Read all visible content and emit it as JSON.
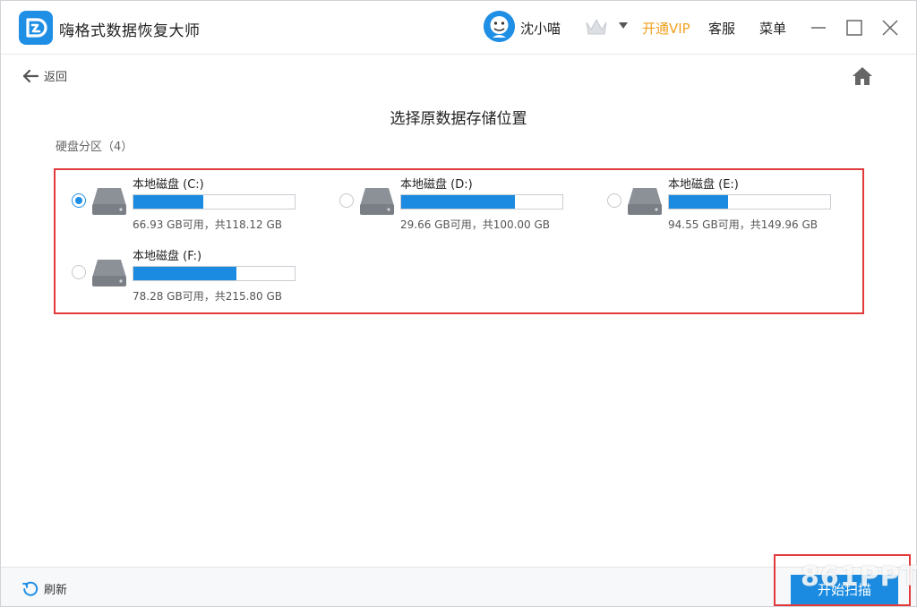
{
  "window": {
    "app_title": "嗨格式数据恢复大师",
    "username": "沈小喵",
    "vip_label": "开通VIP",
    "service_label": "客服",
    "menu_label": "菜单",
    "accent_color": "#1f8fe5",
    "vip_color": "#f0a020"
  },
  "toolbar": {
    "back_label": "返回",
    "home_icon": "home-icon"
  },
  "main": {
    "title": "选择原数据存储位置",
    "section_label": "硬盘分区（4）",
    "drives": [
      {
        "name": "本地磁盘 (C:)",
        "info": "66.93 GB可用，共118.12 GB",
        "used_fraction": 0.433,
        "selected": true
      },
      {
        "name": "本地磁盘 (D:)",
        "info": "29.66 GB可用，共100.00 GB",
        "used_fraction": 0.703,
        "selected": false
      },
      {
        "name": "本地磁盘 (E:)",
        "info": "94.55 GB可用，共149.96 GB",
        "used_fraction": 0.369,
        "selected": false
      },
      {
        "name": "本地磁盘 (F:)",
        "info": "78.28 GB可用，共215.80 GB",
        "used_fraction": 0.637,
        "selected": false
      }
    ]
  },
  "footer": {
    "refresh_label": "刷新",
    "scan_label": "开始扫描",
    "watermark": "861PPT"
  }
}
